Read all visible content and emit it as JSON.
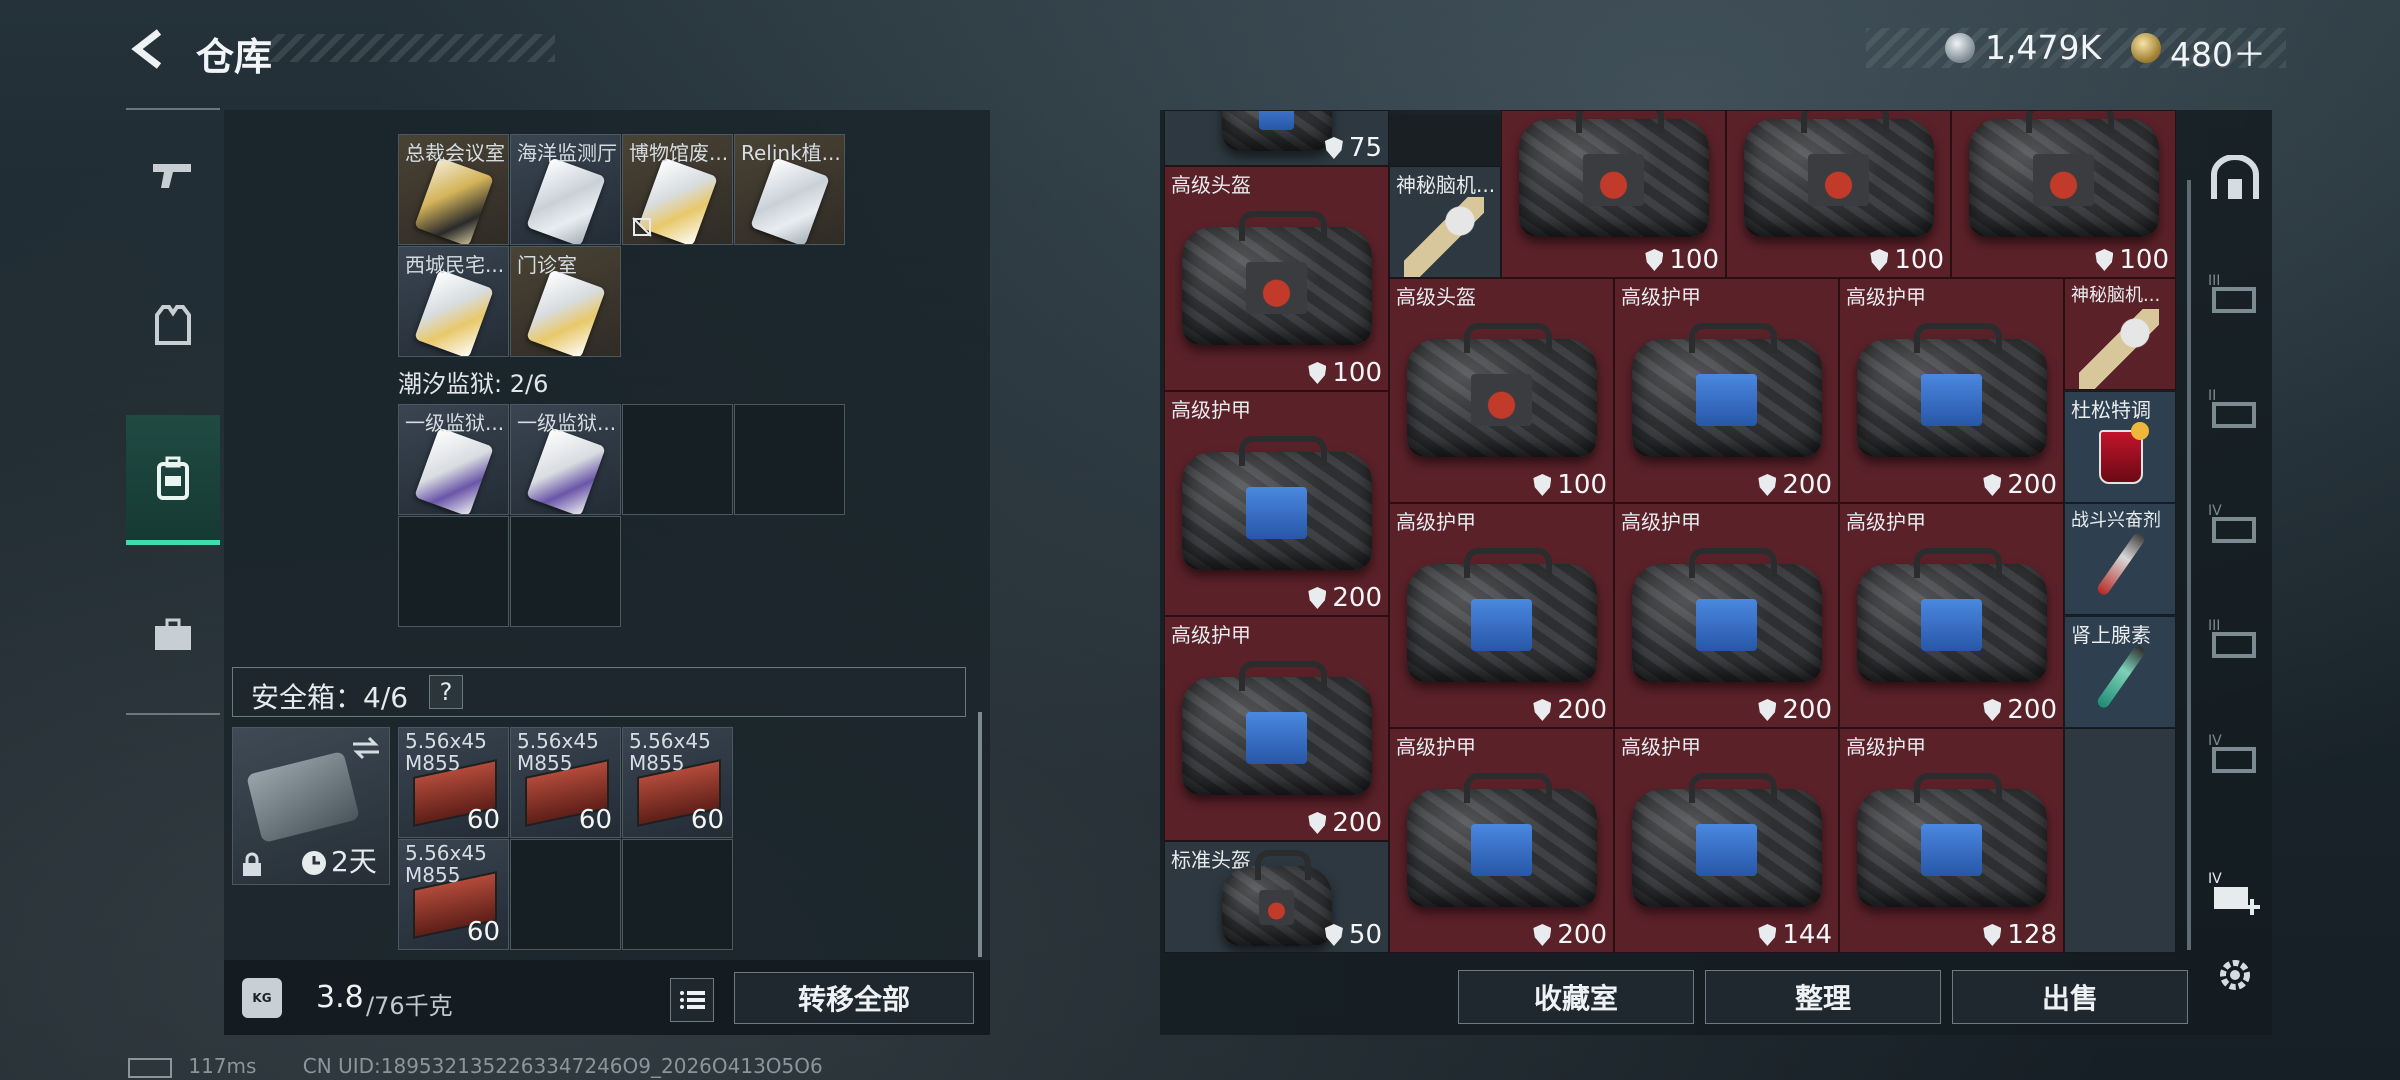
{
  "header": {
    "title": "仓库",
    "silver": "1,479K",
    "gold": "480＋"
  },
  "left_nav": [
    "weapon-tab",
    "equipment-tab",
    "backpack-tab",
    "case-tab"
  ],
  "keycards": {
    "row1": [
      {
        "label": "总裁会议室",
        "style": "gold"
      },
      {
        "label": "海洋监测厅",
        "style": "silver"
      },
      {
        "label": "博物馆废...",
        "style": "silver-gold"
      },
      {
        "label": "Relink植...",
        "style": "silver"
      }
    ],
    "row2": [
      {
        "label": "西城民宅...",
        "style": "silver-gold"
      },
      {
        "label": "门诊室",
        "style": "silver-gold"
      }
    ]
  },
  "prison": {
    "label": "潮汐监狱: 2/6",
    "cards": [
      {
        "label": "一级监狱..."
      },
      {
        "label": "一级监狱..."
      }
    ]
  },
  "safe": {
    "label": "安全箱：4/6",
    "help": "?",
    "timer": "2天",
    "ammo": [
      {
        "label": "5.56x45 M855",
        "qty": "60"
      },
      {
        "label": "5.56x45 M855",
        "qty": "60"
      },
      {
        "label": "5.56x45 M855",
        "qty": "60"
      },
      {
        "label": "5.56x45 M855",
        "qty": "60"
      }
    ]
  },
  "weight": {
    "current": "3.8",
    "max": "/76千克",
    "kg_icon": "KG",
    "transfer_all": "转移全部"
  },
  "stash": {
    "items": [
      {
        "label": "",
        "dur": "75",
        "color": "grey",
        "kind": "bag-blue"
      },
      {
        "label": "",
        "dur": "100",
        "color": "red",
        "kind": "helmet"
      },
      {
        "label": "",
        "dur": "100",
        "color": "red",
        "kind": "helmet"
      },
      {
        "label": "",
        "dur": "100",
        "color": "red",
        "kind": "helmet"
      },
      {
        "label": "高级头盔",
        "dur": "100",
        "color": "red",
        "kind": "helmet"
      },
      {
        "label": "神秘脑机...",
        "dur": "",
        "color": "grey",
        "kind": "device"
      },
      {
        "label": "高级头盔",
        "dur": "100",
        "color": "red",
        "kind": "helmet"
      },
      {
        "label": "高级护甲",
        "dur": "200",
        "color": "red",
        "kind": "armor"
      },
      {
        "label": "高级护甲",
        "dur": "200",
        "color": "red",
        "kind": "armor"
      },
      {
        "label": "神秘脑机...",
        "dur": "",
        "color": "red",
        "kind": "device"
      },
      {
        "label": "高级护甲",
        "dur": "200",
        "color": "red",
        "kind": "armor"
      },
      {
        "label": "杜松特调",
        "dur": "",
        "color": "blue",
        "kind": "drink"
      },
      {
        "label": "高级护甲",
        "dur": "200",
        "color": "red",
        "kind": "armor"
      },
      {
        "label": "高级护甲",
        "dur": "200",
        "color": "red",
        "kind": "armor"
      },
      {
        "label": "高级护甲",
        "dur": "200",
        "color": "red",
        "kind": "armor"
      },
      {
        "label": "战斗兴奋剂",
        "dur": "",
        "color": "blue",
        "kind": "injector"
      },
      {
        "label": "高级护甲",
        "dur": "200",
        "color": "red",
        "kind": "armor"
      },
      {
        "label": "肾上腺素",
        "dur": "",
        "color": "blue",
        "kind": "injector"
      },
      {
        "label": "高级护甲",
        "dur": "200",
        "color": "red",
        "kind": "armor"
      },
      {
        "label": "高级护甲",
        "dur": "144",
        "color": "red",
        "kind": "armor"
      },
      {
        "label": "高级护甲",
        "dur": "128",
        "color": "red",
        "kind": "armor"
      },
      {
        "label": "标准头盔",
        "dur": "50",
        "color": "grey",
        "kind": "helmet-small"
      }
    ]
  },
  "buttons": {
    "collection": "收藏室",
    "sort": "整理",
    "sell": "出售"
  },
  "side_tabs": [
    "III",
    "II",
    "IV",
    "III",
    "IV",
    "IV"
  ],
  "status": {
    "ping": "117ms",
    "uid": "CN UID:1895321352263347246O9_2026O413O5O6"
  }
}
